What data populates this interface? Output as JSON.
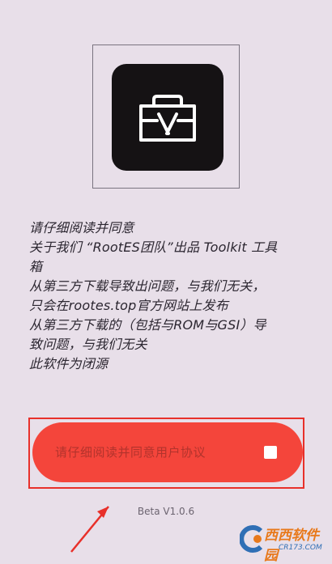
{
  "app_logo": {
    "icon": "toolbox-icon"
  },
  "notice": {
    "lines": [
      "请仔细阅读并同意",
      "关于我们 “RootES团队”出品 Toolkit 工具",
      "箱",
      "从第三方下载导致出问题，与我们无关，",
      "只会在rootes.top官方网站上发布",
      "从第三方下载的（包括与ROM与GSI）导",
      "致问题，与我们无关",
      "此软件为闭源"
    ]
  },
  "agree": {
    "label": "请仔细阅读并同意用户协议",
    "checked": false
  },
  "version": "Beta V1.0.6",
  "watermark": {
    "name": "西西软件园",
    "domain": "CR173.COM"
  },
  "colors": {
    "background": "#e8dfe9",
    "accent": "#f4453b",
    "outline": "#e8302a"
  }
}
